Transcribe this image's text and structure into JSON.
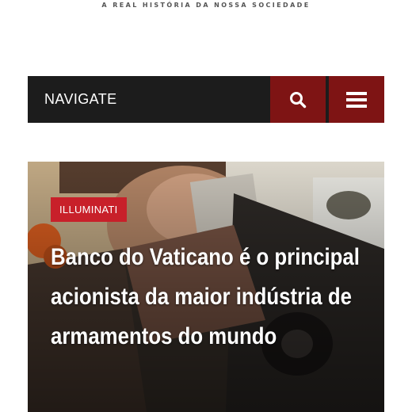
{
  "site": {
    "tagline": "A REAL HISTÓRIA DA NOSSA SOCIEDADE"
  },
  "nav": {
    "label": "NAVIGATE",
    "search_icon": "search-icon",
    "menu_icon": "hamburger-menu-icon",
    "button_color": "#7e1414",
    "bar_color": "#1c1c1c"
  },
  "featured": {
    "category": "ILLUMINATI",
    "category_color": "#c8202a",
    "headline": "Banco do Vaticano é o principal acionista da maior indústria de armamentos do mundo"
  }
}
